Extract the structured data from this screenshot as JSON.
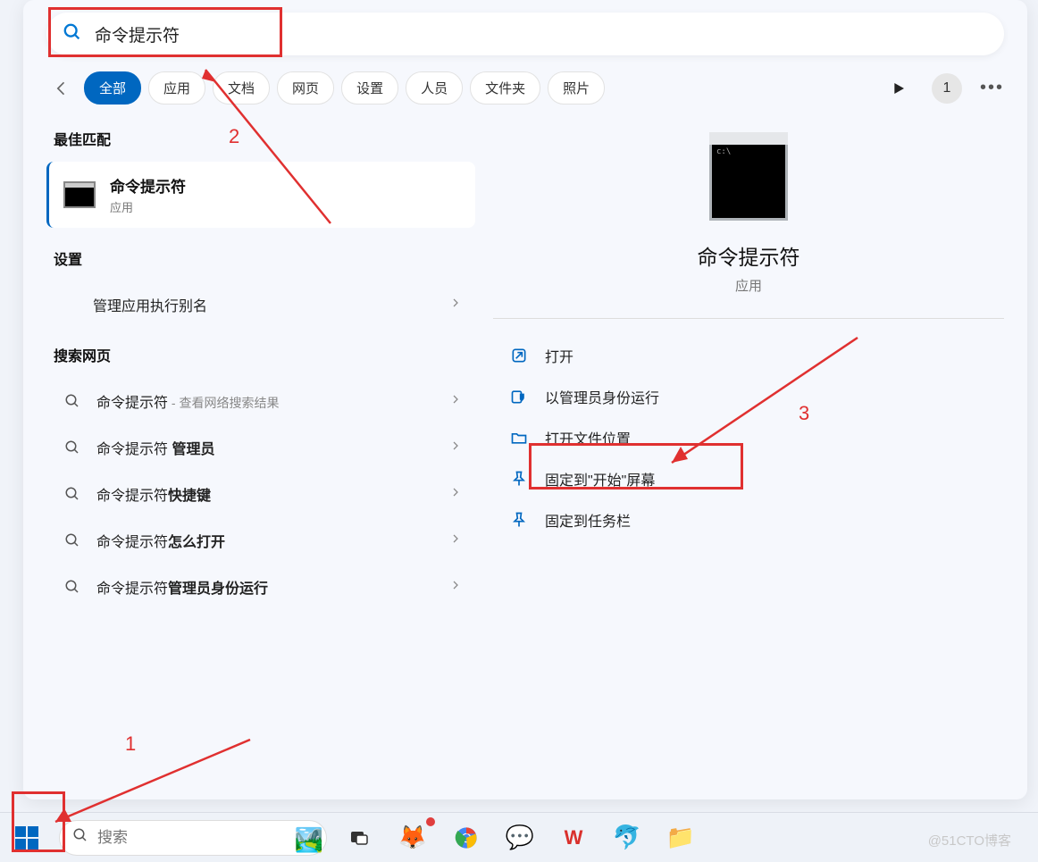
{
  "search": {
    "value": "命令提示符"
  },
  "tabs": [
    "全部",
    "应用",
    "文档",
    "网页",
    "设置",
    "人员",
    "文件夹",
    "照片"
  ],
  "badge": "1",
  "sections": {
    "best_match": "最佳匹配",
    "settings": "设置",
    "search_web": "搜索网页"
  },
  "best_match_item": {
    "title": "命令提示符",
    "sub": "应用"
  },
  "settings_item": "管理应用执行别名",
  "web_suffix": " - 查看网络搜索结果",
  "web_items": [
    {
      "pre": "命令提示符",
      "bold": ""
    },
    {
      "pre": "命令提示符 ",
      "bold": "管理员"
    },
    {
      "pre": "命令提示符",
      "bold": "快捷键"
    },
    {
      "pre": "命令提示符",
      "bold": "怎么打开"
    },
    {
      "pre": "命令提示符",
      "bold": "管理员身份运行"
    }
  ],
  "preview": {
    "title": "命令提示符",
    "sub": "应用"
  },
  "actions": [
    "打开",
    "以管理员身份运行",
    "打开文件位置",
    "固定到\"开始\"屏幕",
    "固定到任务栏"
  ],
  "taskbar_search_placeholder": "搜索",
  "annotations": {
    "n1": "1",
    "n2": "2",
    "n3": "3"
  },
  "watermark": "@51CTO博客"
}
